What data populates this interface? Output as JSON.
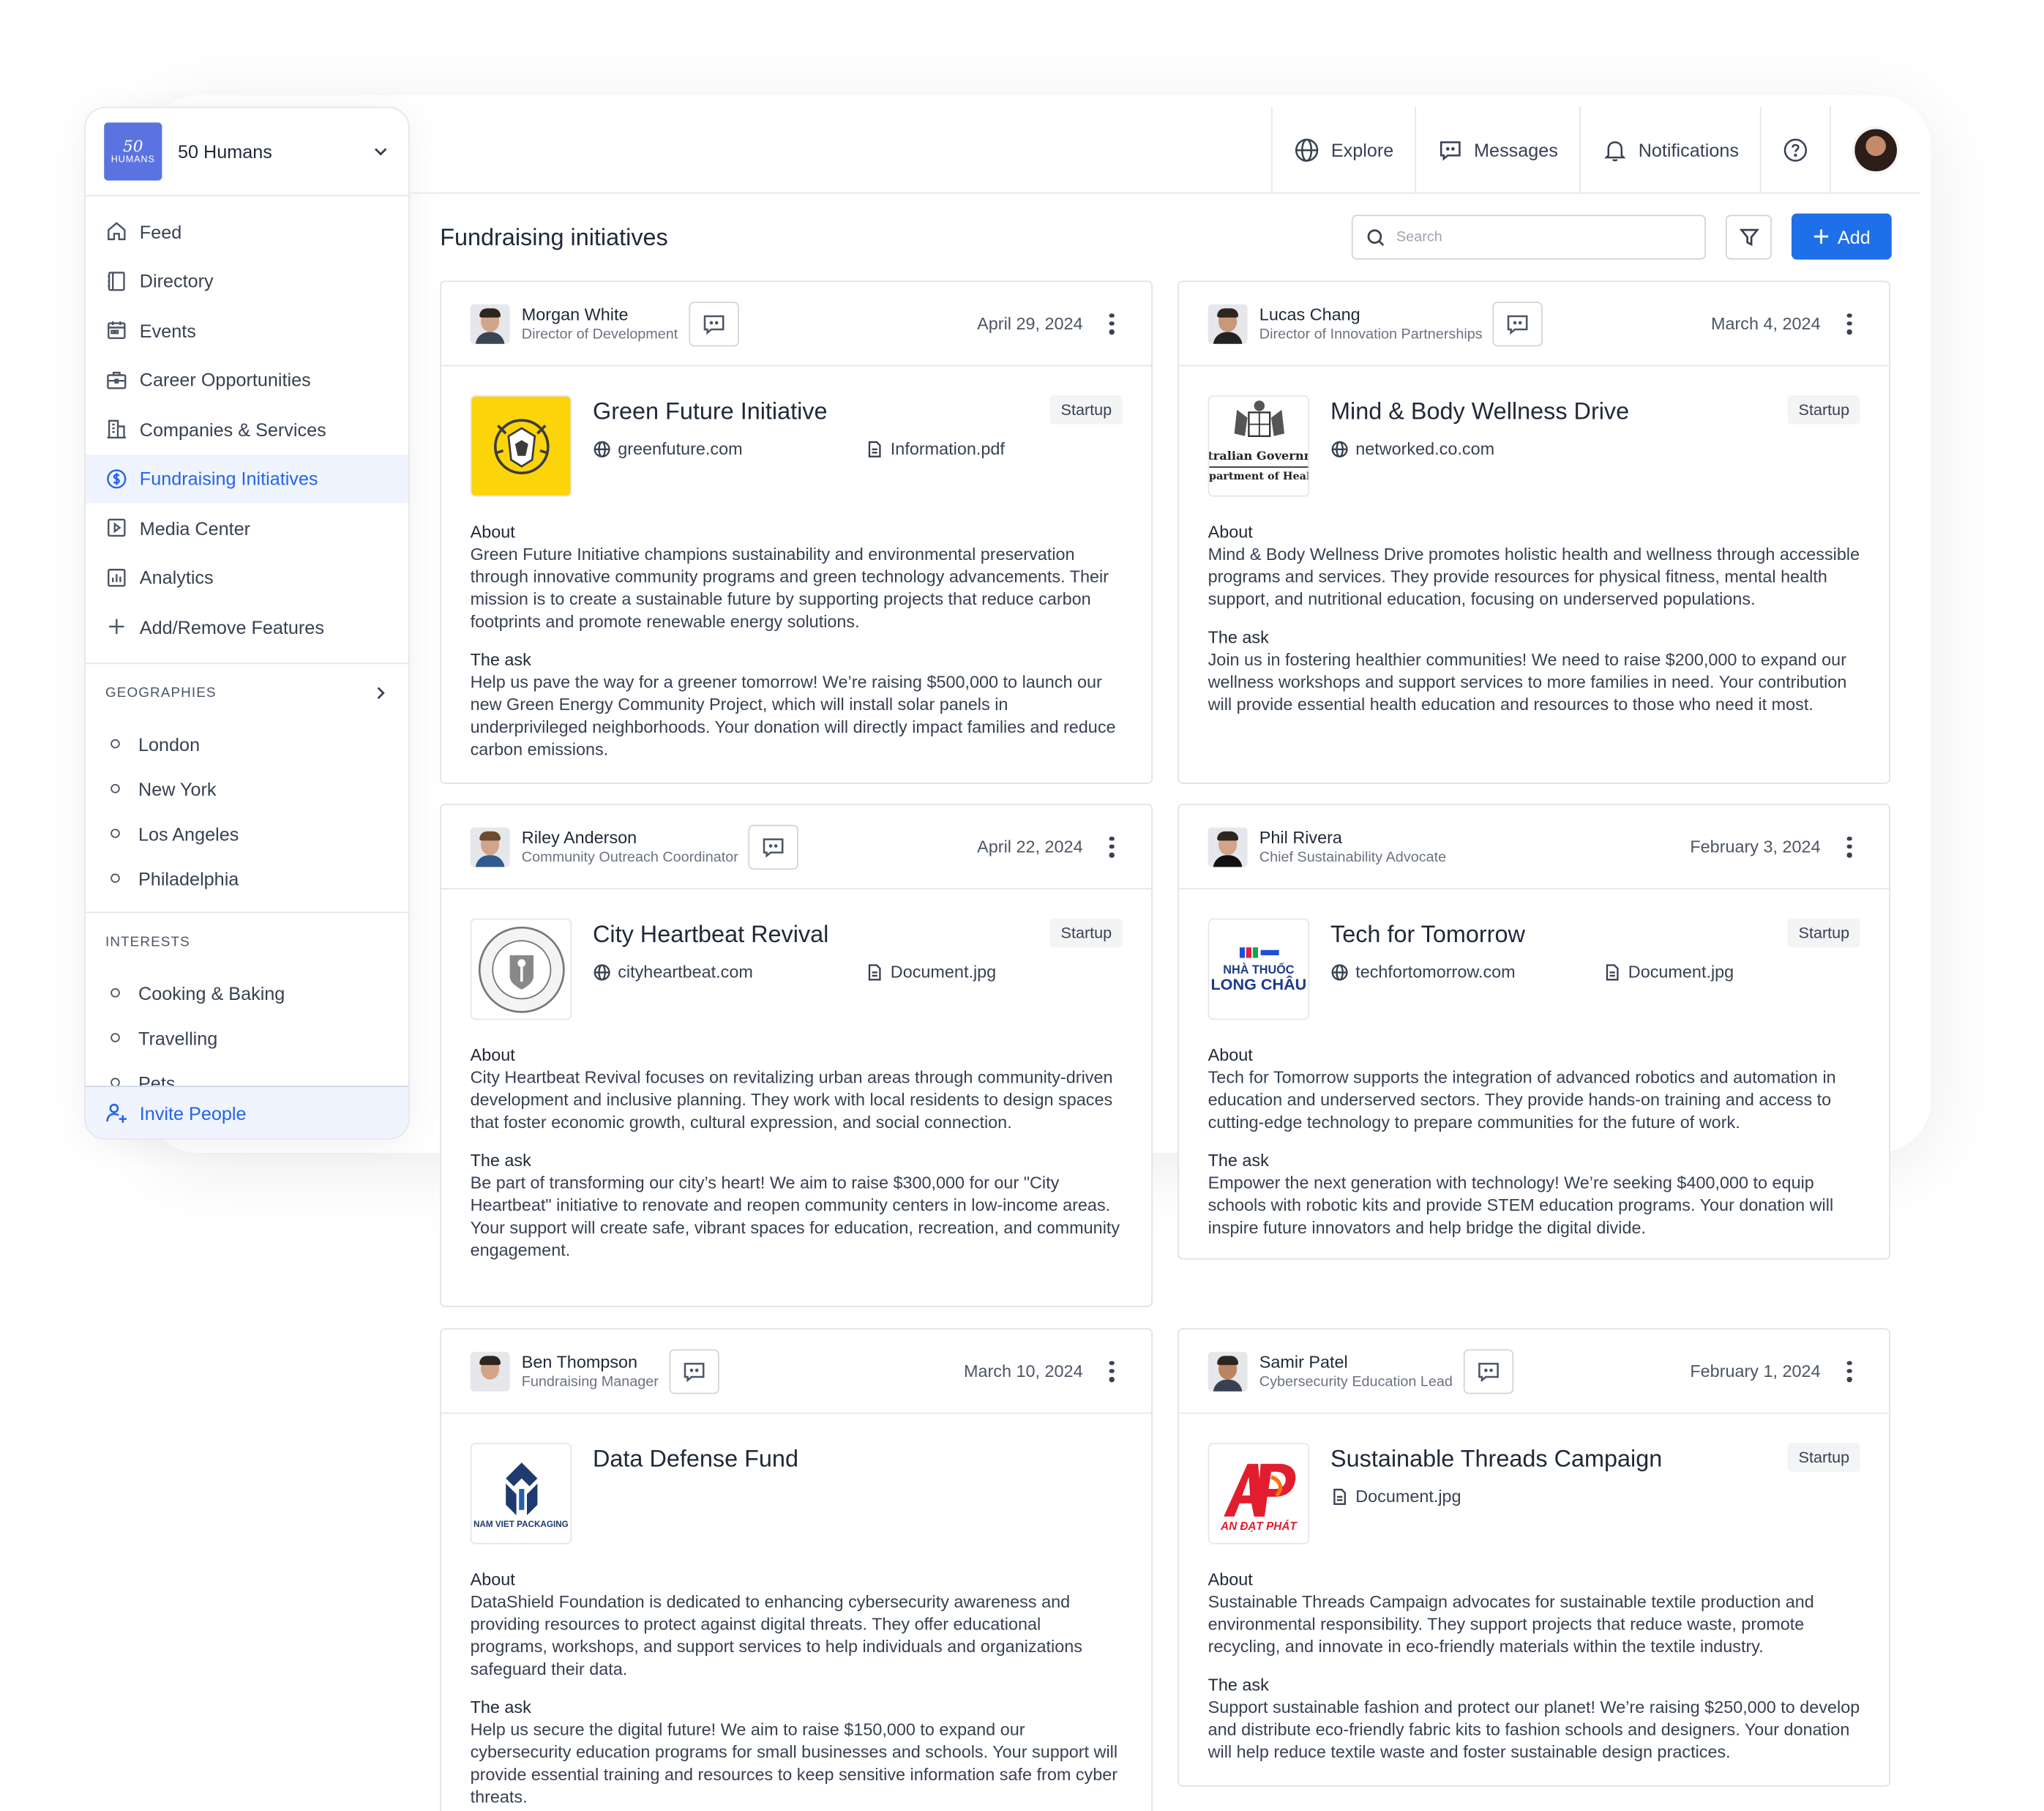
{
  "org": {
    "logo_top": "50",
    "logo_bottom": "HUMANS",
    "name": "50 Humans"
  },
  "nav": [
    {
      "label": "Feed",
      "icon": "home-icon"
    },
    {
      "label": "Directory",
      "icon": "book-icon"
    },
    {
      "label": "Events",
      "icon": "calendar-icon"
    },
    {
      "label": "Career Opportunities",
      "icon": "briefcase-icon"
    },
    {
      "label": "Companies & Services",
      "icon": "building-icon"
    },
    {
      "label": "Fundraising Initiatives",
      "icon": "dollar-circle-icon",
      "active": true
    },
    {
      "label": "Media Center",
      "icon": "play-icon"
    },
    {
      "label": "Analytics",
      "icon": "chart-icon"
    },
    {
      "label": "Add/Remove Features",
      "icon": "plus-icon"
    }
  ],
  "geographies": {
    "title": "GEOGRAPHIES",
    "items": [
      "London",
      "New York",
      "Los Angeles",
      "Philadelphia"
    ]
  },
  "interests": {
    "title": "INTERESTS",
    "items": [
      "Cooking & Baking",
      "Travelling",
      "Pets"
    ]
  },
  "invite_label": "Invite People",
  "topnav": {
    "explore": "Explore",
    "messages": "Messages",
    "notifications": "Notifications"
  },
  "page": {
    "title": "Fundraising initiatives",
    "search_placeholder": "Search",
    "add_label": "Add"
  },
  "colors": {
    "accent": "#1f6fea",
    "active_bg": "#eff4fe"
  },
  "cards": [
    {
      "name": "Morgan White",
      "role": "Director of Development",
      "date": "April 29, 2024",
      "title": "Green Future Initiative",
      "badge": "Startup",
      "website": "greenfuture.com",
      "file": "Information.pdf",
      "about_label": "About",
      "about": "Green Future Initiative champions sustainability and environmental preservation through innovative community programs and green technology advancements. Their mission is to create a sustainable future by supporting projects that reduce carbon footprints and promote renewable energy solutions.",
      "ask_label": "The ask",
      "ask": "Help us pave the way for a greener tomorrow! We’re raising $500,000 to launch our new Green Energy Community Project, which will install solar panels in underprivileged neighborhoods. Your donation will directly impact families and reduce carbon emissions."
    },
    {
      "name": "Lucas Chang",
      "role": "Director of Innovation Partnerships",
      "date": "March 4, 2024",
      "title": "Mind & Body Wellness Drive",
      "badge": "Startup",
      "website": "networked.co.com",
      "file": "",
      "logo_text_1": "stralian Governm",
      "logo_text_2": "epartment of Healt",
      "about_label": "About",
      "about": "Mind & Body Wellness Drive promotes holistic health and wellness through accessible programs and services. They provide resources for physical fitness, mental health support, and nutritional education, focusing on underserved populations.",
      "ask_label": "The ask",
      "ask": "Join us in fostering healthier communities! We need to raise $200,000 to expand our wellness workshops and support services to more families in need. Your contribution will provide essential health education and resources to those who need it most."
    },
    {
      "name": "Riley Anderson",
      "role": "Community Outreach Coordinator",
      "date": "April 22, 2024",
      "title": "City Heartbeat Revival",
      "badge": "Startup",
      "website": "cityheartbeat.com",
      "file": "Document.jpg",
      "about_label": "About",
      "about": "City Heartbeat Revival focuses on revitalizing urban areas through community-driven development and inclusive planning. They work with local residents to design spaces that foster economic growth, cultural expression, and social connection.",
      "ask_label": "The ask",
      "ask": "Be part of transforming our city’s heart! We aim to raise $300,000 for our \"City Heartbeat\" initiative to renovate and reopen community centers in low-income areas. Your support will create safe, vibrant spaces for education, recreation, and community engagement."
    },
    {
      "name": "Phil Rivera",
      "role": "Chief Sustainability Advocate",
      "date": "February 3, 2024",
      "title": "Tech for Tomorrow",
      "badge": "Startup",
      "website": "techfortomorrow.com",
      "file": "Document.jpg",
      "logo_text_1": "NHÀ THUỐC",
      "logo_text_2": "LONG CHÂU",
      "about_label": "About",
      "about": "Tech for Tomorrow supports the integration of advanced robotics and automation in education and underserved sectors. They provide hands-on training and access to cutting-edge technology to prepare communities for the future of work.",
      "ask_label": "The ask",
      "ask": "Empower the next generation with technology! We’re seeking $400,000 to equip schools with robotic kits and provide STEM education programs. Your donation will inspire future innovators and help bridge the digital divide."
    },
    {
      "name": "Ben Thompson",
      "role": "Fundraising Manager",
      "date": "March 10, 2024",
      "title": "Data Defense Fund",
      "badge": "",
      "website": "",
      "file": "",
      "logo_text_1": "NAM VIET PACKAGING",
      "about_label": "About",
      "about": "DataShield Foundation is dedicated to enhancing cybersecurity awareness and providing resources to protect against digital threats. They offer educational programs, workshops, and support services to help individuals and organizations safeguard their data.",
      "ask_label": "The ask",
      "ask": "Help us secure the digital future! We aim to raise $150,000 to expand our cybersecurity education programs for small businesses and schools. Your support will provide essential training and resources to keep sensitive information safe from cyber threats."
    },
    {
      "name": "Samir Patel",
      "role": "Cybersecurity Education Lead",
      "date": "February 1, 2024",
      "title": "Sustainable Threads Campaign",
      "badge": "Startup",
      "website": "",
      "file": "Document.jpg",
      "logo_text_1": "AN ĐẠT PHÁT",
      "about_label": "About",
      "about": "Sustainable Threads Campaign advocates for sustainable textile production and environmental responsibility. They support projects that reduce waste, promote recycling, and innovate in eco-friendly materials within the textile industry.",
      "ask_label": "The ask",
      "ask": "Support sustainable fashion and protect our planet! We’re raising $250,000 to develop and distribute eco-friendly fabric kits to fashion schools and designers. Your donation will help reduce textile waste and foster sustainable design practices."
    }
  ]
}
